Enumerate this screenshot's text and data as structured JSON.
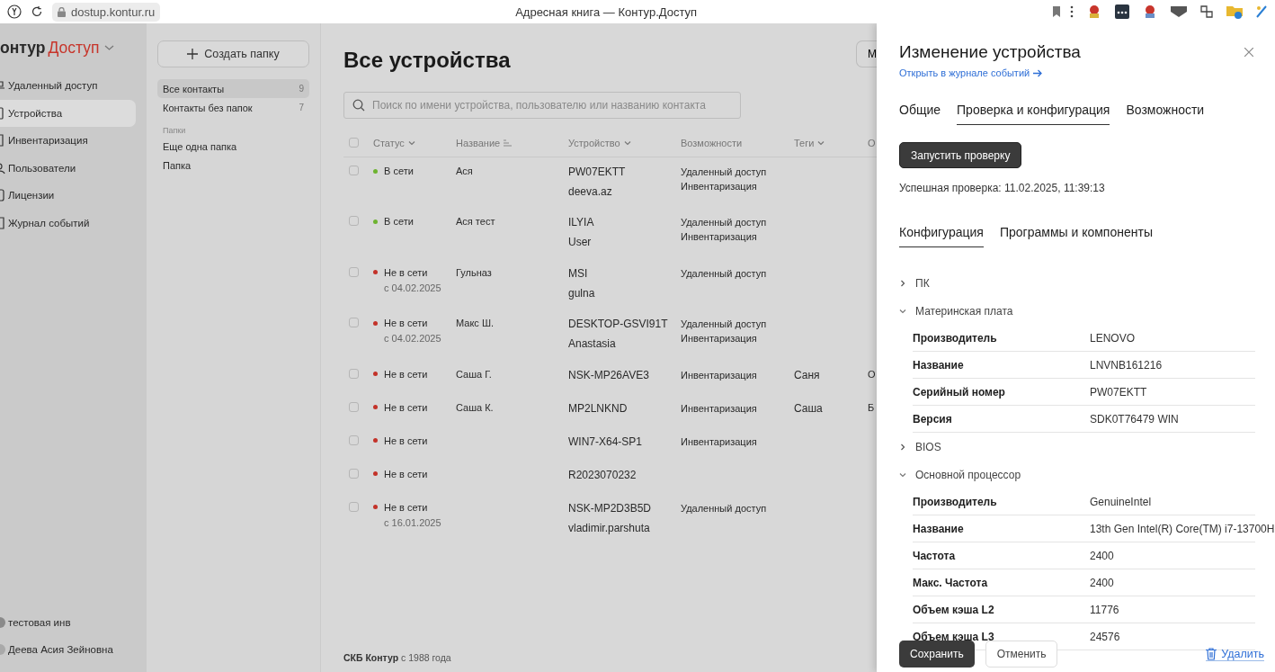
{
  "browser": {
    "url": "dostup.kontur.ru",
    "title": "Адресная книга — Контур.Доступ"
  },
  "sidebar": {
    "logo_left": "онтур",
    "logo_right": "Доступ",
    "items": [
      {
        "label": "Удаленный доступ",
        "selected": false
      },
      {
        "label": "Устройства",
        "selected": true
      },
      {
        "label": "Инвентаризация",
        "selected": false
      },
      {
        "label": "Пользователи",
        "selected": false
      },
      {
        "label": "Лицензии",
        "selected": false
      },
      {
        "label": "Журнал событий",
        "selected": false
      }
    ],
    "workspace": "тестовая инв",
    "user": "Деева Асия Зейновна"
  },
  "folders": {
    "create_button": "Создать папку",
    "items": [
      {
        "label": "Все контакты",
        "count": "9",
        "selected": true
      },
      {
        "label": "Контакты без папок",
        "count": "7",
        "selected": false
      }
    ],
    "section": "Папки",
    "folders": [
      {
        "label": "Еще одна папка",
        "selected": false
      },
      {
        "label": "Папка",
        "selected": false
      }
    ]
  },
  "main": {
    "title": "Все устройства",
    "header_button": "М",
    "search": {
      "placeholder": "Поиск по имени устройства, пользователю или названию контакта"
    },
    "table": {
      "select_all_checked": false,
      "columns": [
        {
          "label": "Статус",
          "kind": "dropdown"
        },
        {
          "label": "Название",
          "kind": "sort"
        },
        {
          "label": "Устройство",
          "kind": "dropdown"
        },
        {
          "label": "Возможности",
          "kind": "plain"
        },
        {
          "label": "Теги",
          "kind": "dropdown"
        },
        {
          "label": "О",
          "kind": "plain"
        }
      ],
      "rows": [
        {
          "checked": false,
          "status": "В сети",
          "color": "#6db32f",
          "name": "Ася",
          "device": "PW07EKTT",
          "user": "deeva.az",
          "capabilities": [
            "Удаленный доступ",
            "Инвентаризация"
          ]
        },
        {
          "checked": false,
          "status": "В сети",
          "color": "#6db32f",
          "name": "Ася тест",
          "device": "ILYIA",
          "user": "User",
          "capabilities": [
            "Удаленный доступ",
            "Инвентаризация"
          ]
        },
        {
          "checked": false,
          "status": "Не в сети",
          "since": "с 04.02.2025",
          "color": "#c33229",
          "name": "Гульназ",
          "device": "MSI",
          "user": "gulna",
          "capabilities": [
            "Удаленный доступ"
          ]
        },
        {
          "checked": false,
          "status": "Не в сети",
          "since": "с 04.02.2025",
          "color": "#c33229",
          "name": "Макс Ш.",
          "device": "DESKTOP-GSVI91T",
          "user": "Anastasia",
          "capabilities": [
            "Удаленный доступ",
            "Инвентаризация"
          ]
        },
        {
          "checked": false,
          "status": "Не в сети",
          "color": "#c33229",
          "name": "Саша Г.",
          "device": "NSK-MP26AVE3",
          "capabilities": [
            "Инвентаризация"
          ],
          "tags": "Саня",
          "column_6": "О"
        },
        {
          "checked": false,
          "status": "Не в сети",
          "color": "#c33229",
          "name": "Саша К.",
          "device": "MP2LNKND",
          "capabilities": [
            "Инвентаризация"
          ],
          "tags": "Саша",
          "column_6": "Б"
        },
        {
          "checked": false,
          "status": "Не в сети",
          "color": "#c33229",
          "device": "WIN7-X64-SP1",
          "capabilities": [
            "Инвентаризация"
          ]
        },
        {
          "checked": false,
          "status": "Не в сети",
          "color": "#c33229",
          "device": "R2023070232"
        },
        {
          "checked": false,
          "status": "Не в сети",
          "since": "с 16.01.2025",
          "color": "#c33229",
          "device": "NSK-MP2D3B5D",
          "user": "vladimir.parshuta",
          "capabilities": [
            "Удаленный доступ"
          ]
        }
      ]
    },
    "footer_bold": "СКБ Контур",
    "footer_text": "с 1988 года"
  },
  "drawer": {
    "title": "Изменение устройства",
    "log_link": "Открыть в журнале событий",
    "tabs": [
      {
        "label": "Общие",
        "selected": false
      },
      {
        "label": "Проверка и конфигурация",
        "selected": true
      },
      {
        "label": "Возможности",
        "selected": false
      }
    ],
    "run_button": "Запустить проверку",
    "last_check": "Успешная проверка: 11.02.2025, 11:39:13",
    "subtabs": [
      {
        "label": "Конфигурация",
        "selected": true
      },
      {
        "label": "Программы и компоненты",
        "selected": false
      }
    ],
    "tree": [
      {
        "label": "ПК",
        "expanded": false
      },
      {
        "label": "Материнская плата",
        "expanded": true,
        "children": [
          {
            "name": "Производитель",
            "value": "LENOVO"
          },
          {
            "name": "Название",
            "value": "LNVNB161216"
          },
          {
            "name": "Серийный номер",
            "value": "PW07EKTT"
          },
          {
            "name": "Версия",
            "value": "SDK0T76479 WIN"
          }
        ]
      },
      {
        "label": "BIOS",
        "expanded": false
      },
      {
        "label": "Основной процессор",
        "expanded": true,
        "children": [
          {
            "name": "Производитель",
            "value": "GenuineIntel"
          },
          {
            "name": "Название",
            "value": "13th Gen Intel(R) Core(TM) i7-13700H"
          },
          {
            "name": "Частота",
            "value": "2400"
          },
          {
            "name": "Макс. Частота",
            "value": "2400"
          },
          {
            "name": "Объем кэша L2",
            "value": "11776"
          },
          {
            "name": "Объем кэша L3",
            "value": "24576"
          }
        ]
      }
    ],
    "save_button": "Сохранить",
    "cancel_button": "Отменить",
    "delete_link": "Удалить"
  }
}
